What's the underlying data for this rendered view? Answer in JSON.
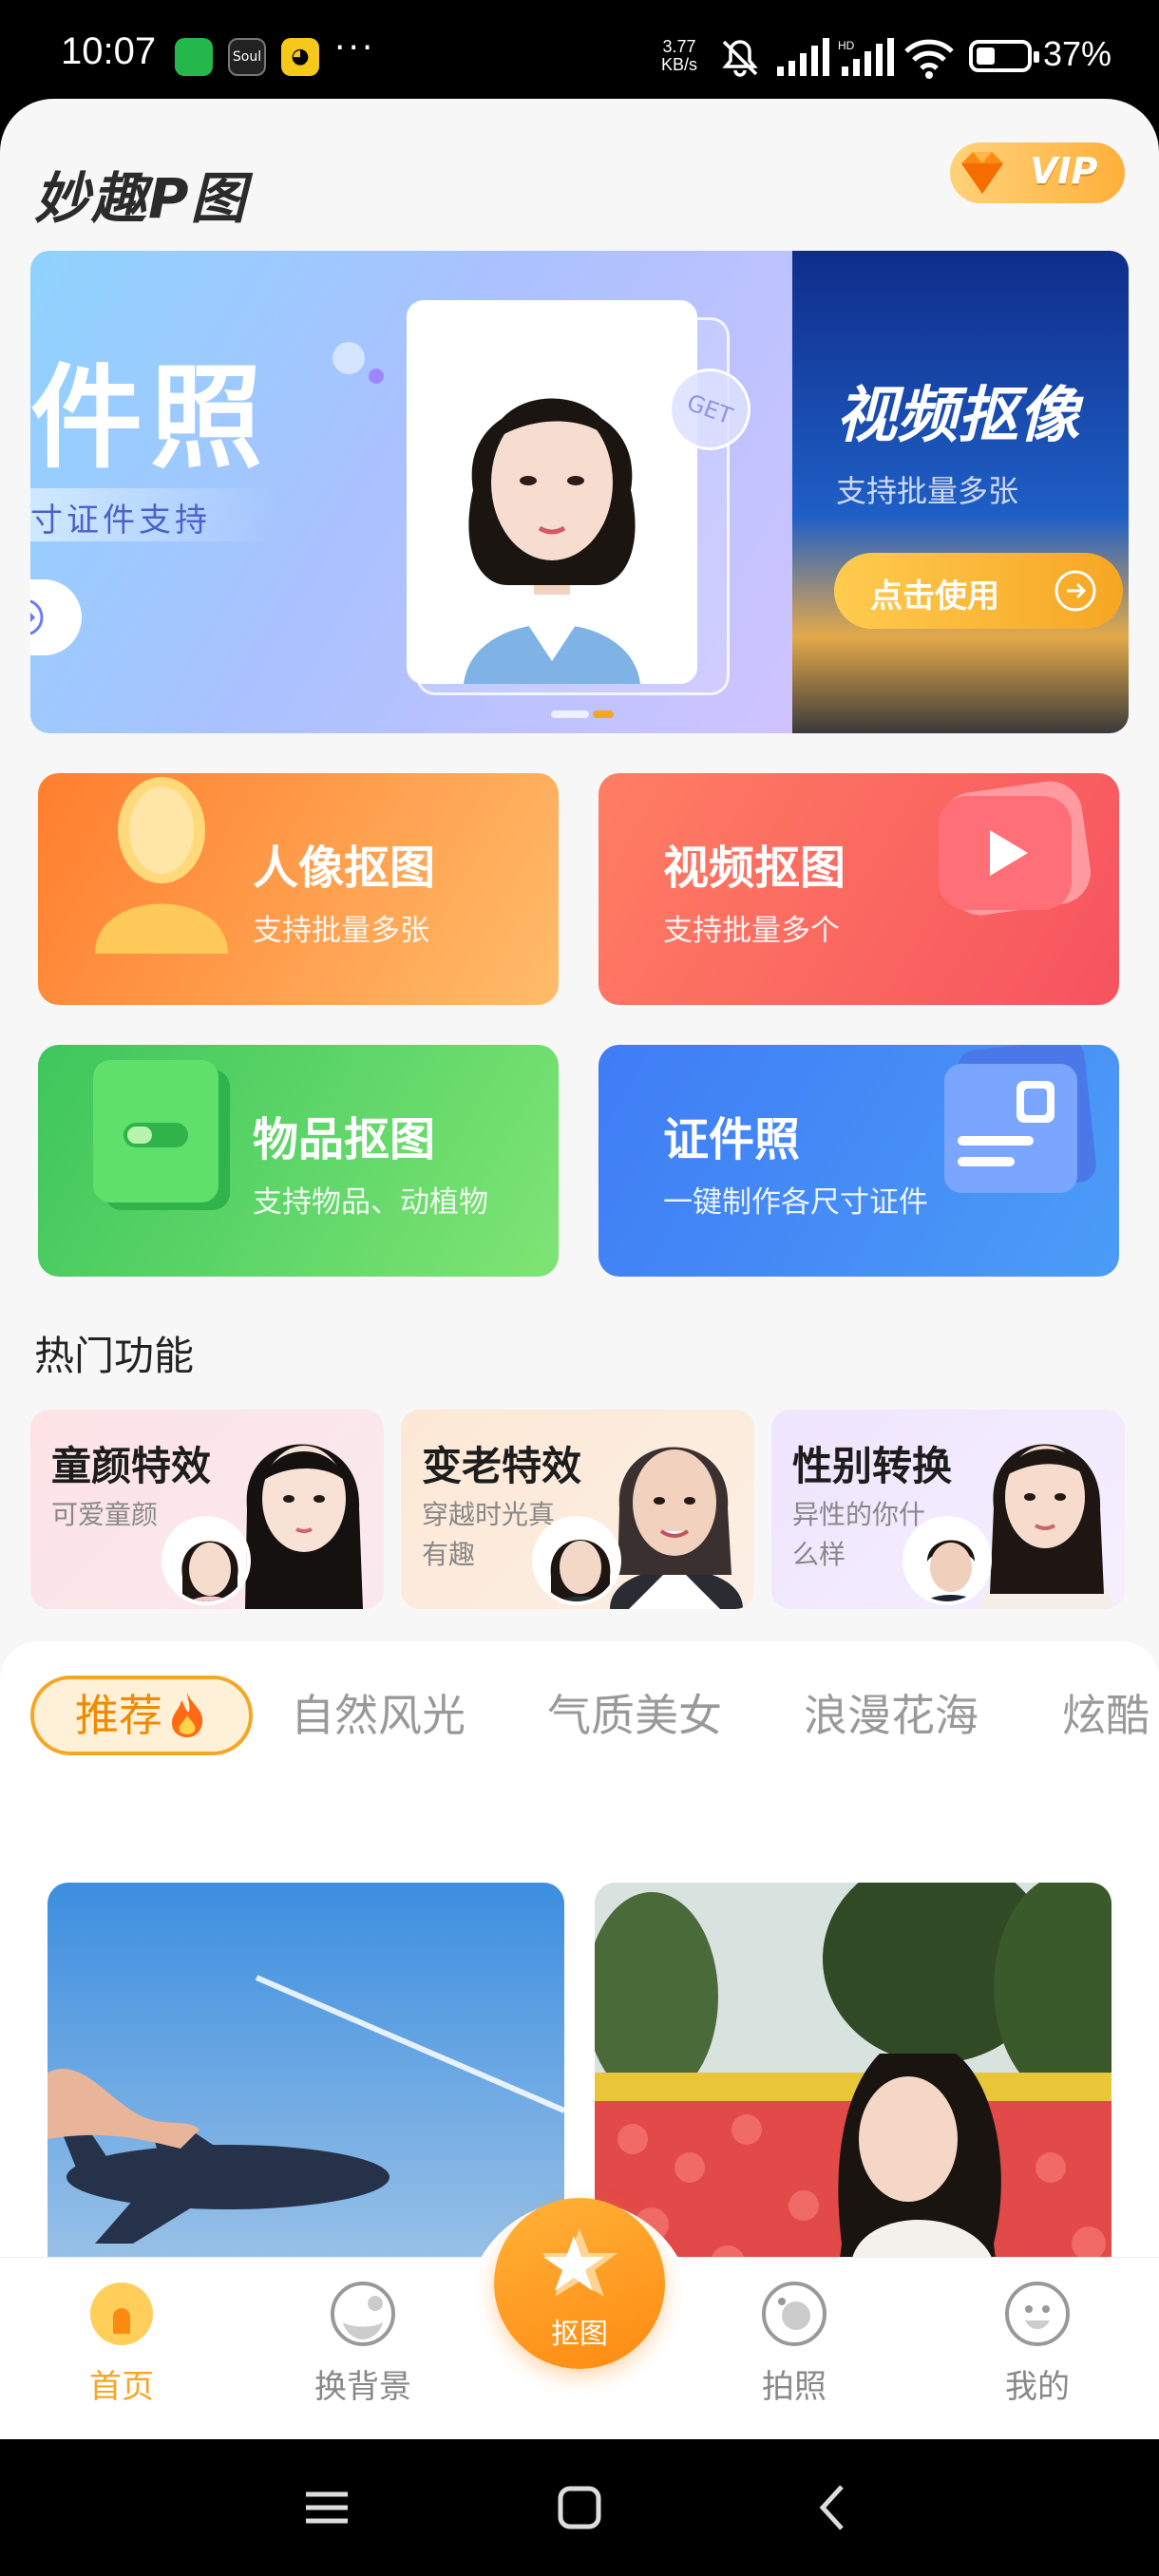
{
  "status_bar": {
    "time": "10:07",
    "app_icons": [
      "green-app-icon",
      "soul-app-icon",
      "yellow-app-icon"
    ],
    "soul_label": "Soul",
    "more": "···",
    "net_speed_value": "3.77",
    "net_speed_unit": "KB/s",
    "network": "HD",
    "battery_percent": "37%",
    "battery_level": 0.37
  },
  "header": {
    "logo": "妙趣P图",
    "vip_label": "VIP"
  },
  "banner": {
    "left_title": "件照",
    "left_subtitle": "寸证件支持",
    "get_badge": "GET",
    "right_title": "视频抠像",
    "right_subtitle": "支持批量多张",
    "right_button": "点击使用",
    "active_slide": 1,
    "slides": 2
  },
  "features": [
    {
      "title": "人像抠图",
      "subtitle": "支持批量多张",
      "icon": "portrait-icon"
    },
    {
      "title": "视频抠图",
      "subtitle": "支持批量多个",
      "icon": "video-play-icon"
    },
    {
      "title": "物品抠图",
      "subtitle": "支持物品、动植物",
      "icon": "box-icon"
    },
    {
      "title": "证件照",
      "subtitle": "一键制作各尺寸证件",
      "icon": "id-card-icon"
    }
  ],
  "hot": {
    "title": "热门功能",
    "items": [
      {
        "title": "童颜特效",
        "subtitle": "可爱童颜"
      },
      {
        "title": "变老特效",
        "subtitle": "穿越时光真有趣"
      },
      {
        "title": "性别转换",
        "subtitle": "异性的你什么样"
      }
    ]
  },
  "categories": {
    "tabs": [
      "推荐",
      "自然风光",
      "气质美女",
      "浪漫花海",
      "炫酷"
    ],
    "active": 0
  },
  "bottom_nav": {
    "items": [
      {
        "label": "首页",
        "icon": "home-icon"
      },
      {
        "label": "换背景",
        "icon": "change-background-icon"
      },
      {
        "label": "抠图",
        "icon": "cutout-icon"
      },
      {
        "label": "拍照",
        "icon": "camera-icon"
      },
      {
        "label": "我的",
        "icon": "profile-icon"
      }
    ],
    "active": 0,
    "accent": "#f6a623"
  },
  "colors": {
    "accent": "#f6a623",
    "portrait_card": "#ff8d3b",
    "video_card": "#f65f60",
    "object_card": "#4cd160",
    "id_card": "#3f82f5"
  }
}
